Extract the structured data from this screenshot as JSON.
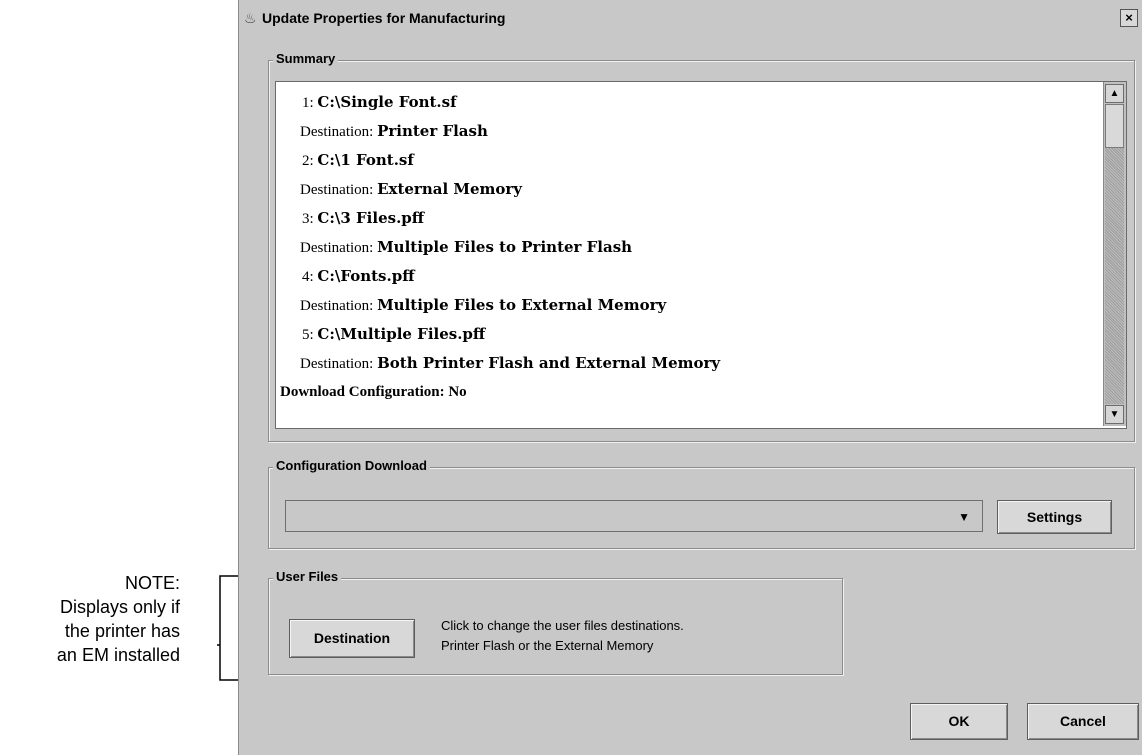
{
  "side_note": {
    "lines": [
      "NOTE:",
      "Displays only if",
      "the printer has",
      "an EM installed"
    ]
  },
  "dialog": {
    "icon": "java-coffee-cup-icon",
    "title": "Update Properties for Manufacturing",
    "close_label": "×"
  },
  "summary": {
    "legend": "Summary",
    "entries": [
      {
        "num": "1:",
        "file": "C:\\Single Font.sf",
        "dest_label": "Destination:",
        "dest": "Printer Flash"
      },
      {
        "num": "2:",
        "file": "C:\\1 Font.sf",
        "dest_label": "Destination:",
        "dest": "External Memory"
      },
      {
        "num": "3:",
        "file": "C:\\3 Files.pff",
        "dest_label": "Destination:",
        "dest": "Multiple Files to Printer Flash"
      },
      {
        "num": "4:",
        "file": "C:\\Fonts.pff",
        "dest_label": "Destination:",
        "dest": "Multiple Files to External Memory"
      },
      {
        "num": "5:",
        "file": "C:\\Multiple Files.pff",
        "dest_label": "Destination:",
        "dest": "Both Printer Flash and External Memory"
      }
    ],
    "download_config": "Download Configuration: No",
    "scroll_up": "▲",
    "scroll_down": "▼"
  },
  "config_download": {
    "legend": "Configuration Download",
    "selected": "",
    "dropdown_arrow": "▼",
    "settings_label": "Settings"
  },
  "user_files": {
    "legend": "User Files",
    "destination_label": "Destination",
    "description_line1": "Click to change the user files destinations.",
    "description_line2": "Printer Flash or the External Memory"
  },
  "footer": {
    "ok_label": "OK",
    "cancel_label": "Cancel"
  }
}
